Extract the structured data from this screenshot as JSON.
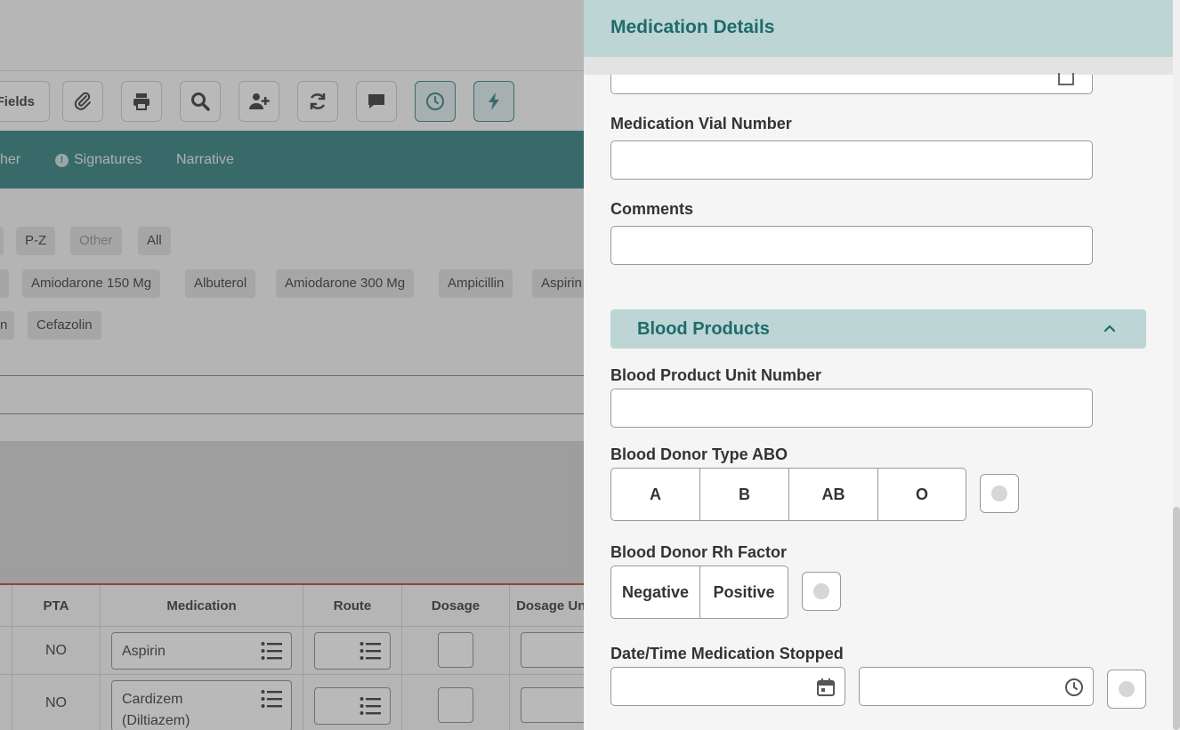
{
  "background": {
    "toolbar": {
      "fields_label": "Fields",
      "buttons": [
        "paperclip-icon",
        "printer-icon",
        "search-icon",
        "add-user-icon",
        "refresh-icon",
        "comment-icon",
        "clock-icon",
        "lightning-icon"
      ]
    },
    "tabs": [
      {
        "label": "her"
      },
      {
        "label": "Signatures",
        "warning": "!"
      },
      {
        "label": "Narrative"
      }
    ],
    "filter_chips": [
      "P-Z",
      "Other",
      "All"
    ],
    "med_chips_row1": [
      "Amiodarone 150 Mg",
      "Albuterol",
      "Amiodarone 300 Mg",
      "Ampicillin",
      "Aspirin"
    ],
    "med_chips_row2": [
      "n",
      "Cefazolin"
    ],
    "table": {
      "headers": [
        "PTA",
        "Medication",
        "Route",
        "Dosage",
        "Dosage Units"
      ],
      "rows": [
        {
          "pta": "NO",
          "medication": "Aspirin"
        },
        {
          "pta": "NO",
          "medication": "Cardizem (Diltiazem)"
        }
      ]
    }
  },
  "panel": {
    "title": "Medication Details",
    "fields": {
      "vial_number": {
        "label": "Medication Vial Number",
        "value": ""
      },
      "comments": {
        "label": "Comments",
        "value": ""
      }
    },
    "blood_products": {
      "section_title": "Blood Products",
      "unit_number": {
        "label": "Blood Product Unit Number",
        "value": ""
      },
      "donor_type": {
        "label": "Blood Donor Type ABO",
        "options": [
          "A",
          "B",
          "AB",
          "O"
        ]
      },
      "rh_factor": {
        "label": "Blood Donor Rh Factor",
        "options": [
          "Negative",
          "Positive"
        ]
      },
      "stopped": {
        "label": "Date/Time Medication Stopped",
        "date": "",
        "time": ""
      }
    }
  }
}
